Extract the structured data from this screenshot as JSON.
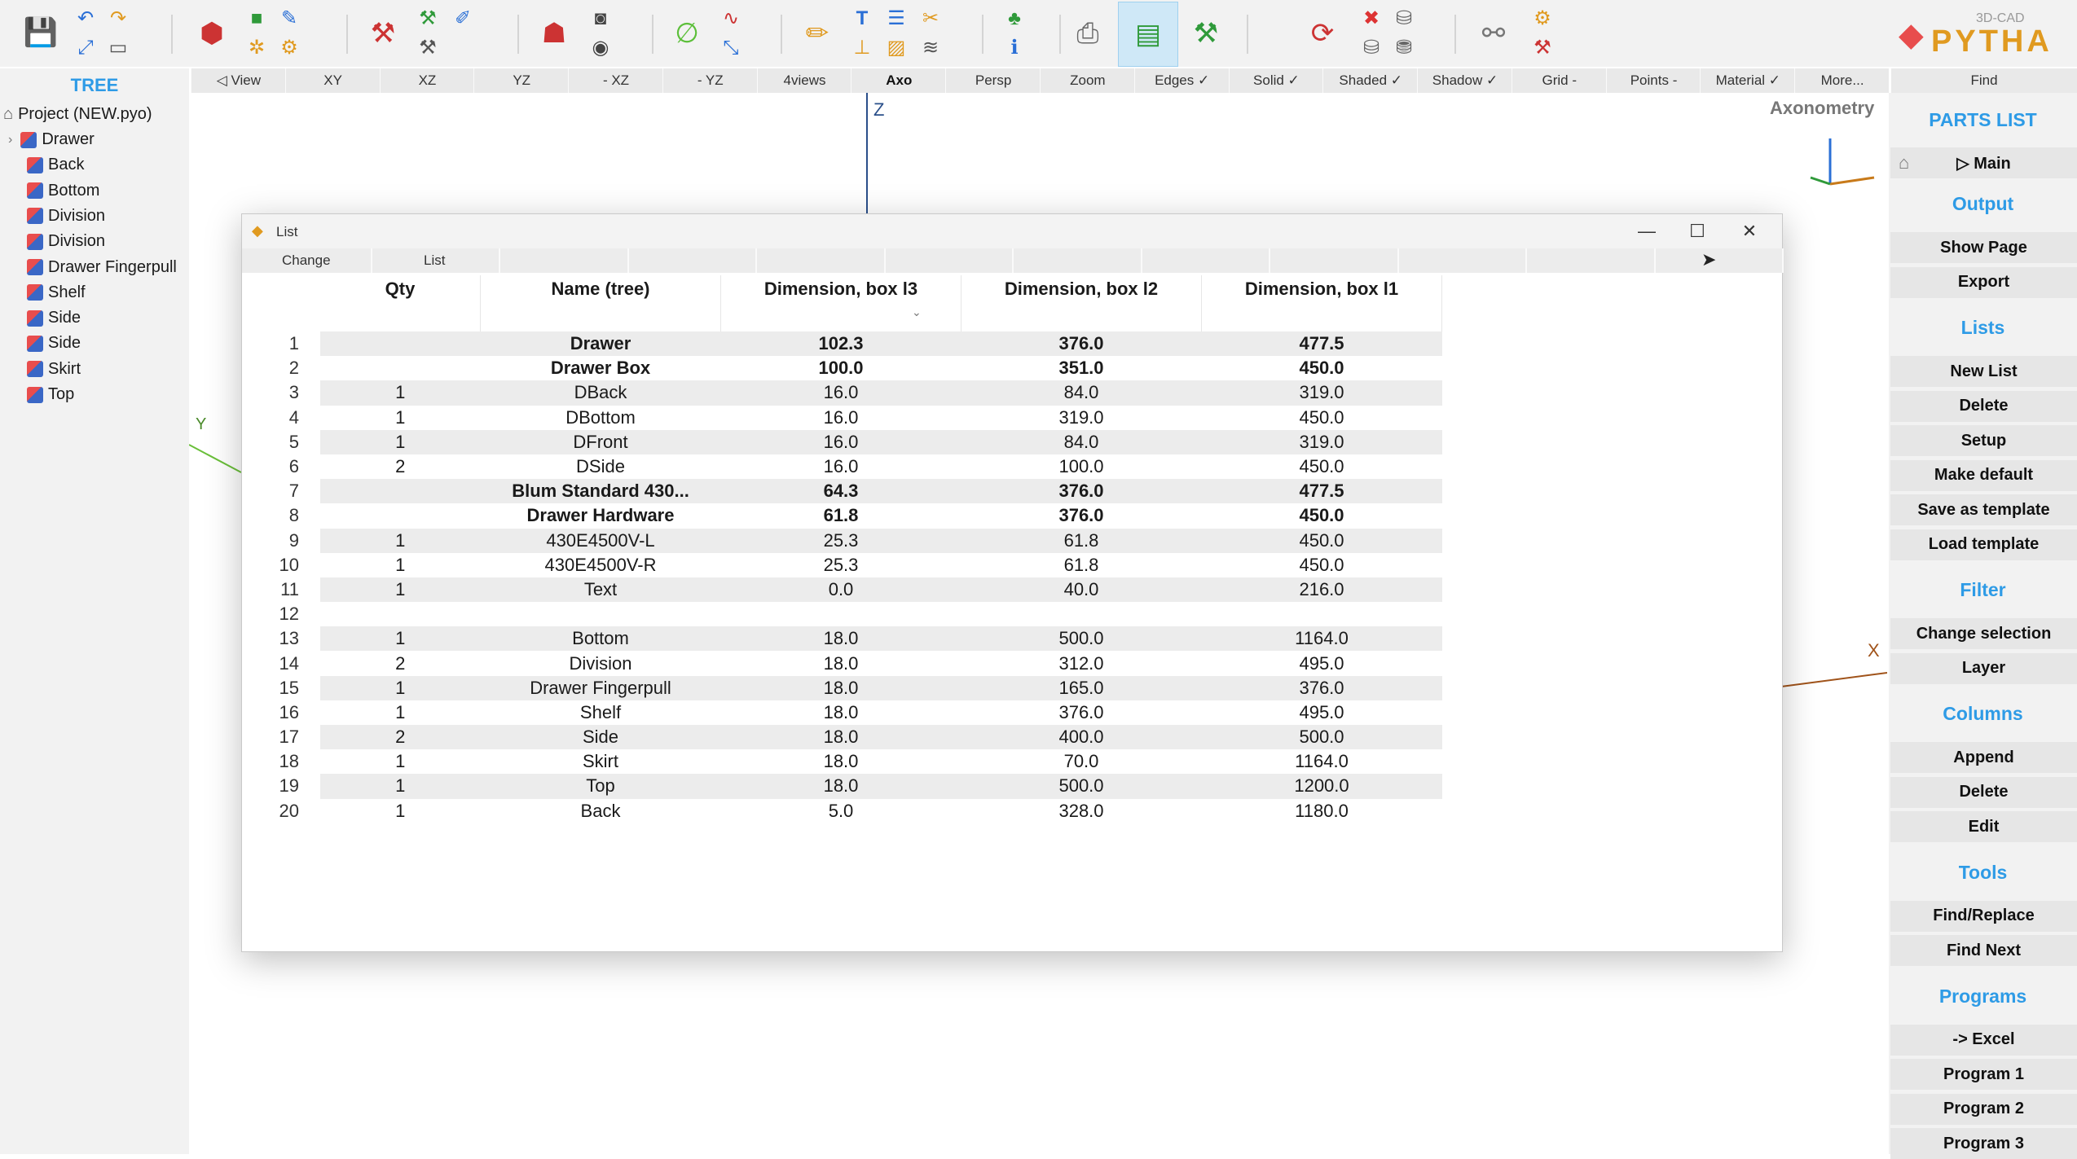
{
  "toolbar": {
    "icons": [
      "save-icon",
      "undo-icon",
      "redo-icon",
      "wizard-icon",
      "brush-icon",
      "model-icon",
      "plus-object-icon",
      "pencil-draw-icon",
      "settings-gear-icon",
      "hammer-icon",
      "tools-icon",
      "measure-icon",
      "person-icon",
      "camera-icon",
      "eye-icon",
      "angle-icon",
      "curve-icon",
      "transform-icon",
      "edit-pencil-icon",
      "text-icon",
      "line-style-icon",
      "scissors-icon",
      "hatch-icon",
      "layers-icon",
      "tree-icon",
      "info-icon",
      "printer-icon",
      "parts-list-icon",
      "drill-icon",
      "refresh-icon",
      "delete-red-icon",
      "stack-icon",
      "stack2-icon",
      "sofa-icon",
      "wrench-icon",
      "logo-icon"
    ],
    "logo_text": "PYTHA",
    "logo_sub": "3D-CAD"
  },
  "viewbar": {
    "buttons": [
      "◁ View",
      "XY",
      "XZ",
      "YZ",
      "- XZ",
      "- YZ",
      "4views",
      "Axo",
      "Persp",
      "Zoom",
      "Edges ✓",
      "Solid ✓",
      "Shaded ✓",
      "Shadow ✓",
      "Grid -",
      "Points -",
      "Material ✓",
      "More..."
    ],
    "active": "Axo",
    "find": "Find"
  },
  "tree": {
    "title": "TREE",
    "project": "Project (NEW.pyo)",
    "items": [
      "Drawer",
      "Back",
      "Bottom",
      "Division",
      "Division",
      "Drawer Fingerpull",
      "Shelf",
      "Side",
      "Side",
      "Skirt",
      "Top"
    ]
  },
  "view3d": {
    "label": "Axonometry",
    "axis_z": "Z",
    "axis_y": "Y",
    "axis_x": "X"
  },
  "listwin": {
    "title": "List",
    "tabs": [
      "Change",
      "List"
    ],
    "columns": [
      "Qty",
      "Name (tree)",
      "Dimension, box l3",
      "Dimension, box l2",
      "Dimension, box l1"
    ],
    "rows": [
      {
        "n": "1",
        "qty": "",
        "name": "Drawer",
        "d3": "102.3",
        "d2": "376.0",
        "d1": "477.5",
        "bold": true,
        "indent": 0
      },
      {
        "n": "2",
        "qty": "",
        "name": "Drawer Box",
        "d3": "100.0",
        "d2": "351.0",
        "d1": "450.0",
        "bold": true,
        "indent": 1
      },
      {
        "n": "3",
        "qty": "1",
        "name": "DBack",
        "d3": "16.0",
        "d2": "84.0",
        "d1": "319.0",
        "bold": false,
        "indent": 2
      },
      {
        "n": "4",
        "qty": "1",
        "name": "DBottom",
        "d3": "16.0",
        "d2": "319.0",
        "d1": "450.0",
        "bold": false,
        "indent": 2
      },
      {
        "n": "5",
        "qty": "1",
        "name": "DFront",
        "d3": "16.0",
        "d2": "84.0",
        "d1": "319.0",
        "bold": false,
        "indent": 2
      },
      {
        "n": "6",
        "qty": "2",
        "name": "DSide",
        "d3": "16.0",
        "d2": "100.0",
        "d1": "450.0",
        "bold": false,
        "indent": 2
      },
      {
        "n": "7",
        "qty": "",
        "name": "Blum Standard 430...",
        "d3": "64.3",
        "d2": "376.0",
        "d1": "477.5",
        "bold": true,
        "indent": 1
      },
      {
        "n": "8",
        "qty": "",
        "name": "Drawer Hardware",
        "d3": "61.8",
        "d2": "376.0",
        "d1": "450.0",
        "bold": true,
        "indent": 2
      },
      {
        "n": "9",
        "qty": "1",
        "name": "430E4500V-L",
        "d3": "25.3",
        "d2": "61.8",
        "d1": "450.0",
        "bold": false,
        "indent": 3
      },
      {
        "n": "10",
        "qty": "1",
        "name": "430E4500V-R",
        "d3": "25.3",
        "d2": "61.8",
        "d1": "450.0",
        "bold": false,
        "indent": 3
      },
      {
        "n": "11",
        "qty": "1",
        "name": "Text",
        "d3": "0.0",
        "d2": "40.0",
        "d1": "216.0",
        "bold": false,
        "indent": 2
      },
      {
        "n": "12",
        "qty": "",
        "name": "",
        "d3": "",
        "d2": "",
        "d1": "",
        "bold": false,
        "indent": 0
      },
      {
        "n": "13",
        "qty": "1",
        "name": "Bottom",
        "d3": "18.0",
        "d2": "500.0",
        "d1": "1164.0",
        "bold": false,
        "indent": 0
      },
      {
        "n": "14",
        "qty": "2",
        "name": "Division",
        "d3": "18.0",
        "d2": "312.0",
        "d1": "495.0",
        "bold": false,
        "indent": 0
      },
      {
        "n": "15",
        "qty": "1",
        "name": "Drawer Fingerpull",
        "d3": "18.0",
        "d2": "165.0",
        "d1": "376.0",
        "bold": false,
        "indent": 0
      },
      {
        "n": "16",
        "qty": "1",
        "name": "Shelf",
        "d3": "18.0",
        "d2": "376.0",
        "d1": "495.0",
        "bold": false,
        "indent": 0
      },
      {
        "n": "17",
        "qty": "2",
        "name": "Side",
        "d3": "18.0",
        "d2": "400.0",
        "d1": "500.0",
        "bold": false,
        "indent": 0
      },
      {
        "n": "18",
        "qty": "1",
        "name": "Skirt",
        "d3": "18.0",
        "d2": "70.0",
        "d1": "1164.0",
        "bold": false,
        "indent": 0
      },
      {
        "n": "19",
        "qty": "1",
        "name": "Top",
        "d3": "18.0",
        "d2": "500.0",
        "d1": "1200.0",
        "bold": false,
        "indent": 0
      },
      {
        "n": "20",
        "qty": "1",
        "name": "Back",
        "d3": "5.0",
        "d2": "328.0",
        "d1": "1180.0",
        "bold": false,
        "indent": 0
      }
    ]
  },
  "rightpanel": {
    "title": "PARTS LIST",
    "main": "▷ Main",
    "sections": [
      {
        "heading": "Output",
        "buttons": [
          "Show Page",
          "Export"
        ]
      },
      {
        "heading": "Lists",
        "buttons": [
          "New List",
          "Delete",
          "Setup",
          "Make default",
          "Save as template",
          "Load template"
        ]
      },
      {
        "heading": "Filter",
        "buttons": [
          "Change selection",
          "Layer"
        ]
      },
      {
        "heading": "Columns",
        "buttons": [
          "Append",
          "Delete",
          "Edit"
        ]
      },
      {
        "heading": "Tools",
        "buttons": [
          "Find/Replace",
          "Find Next"
        ]
      },
      {
        "heading": "Programs",
        "buttons": [
          "-> Excel",
          "Program 1",
          "Program 2",
          "Program 3"
        ]
      }
    ]
  },
  "colors": {
    "accent": "#2e9be6",
    "panel": "#f2f2f2",
    "row_alt": "#ececec"
  }
}
